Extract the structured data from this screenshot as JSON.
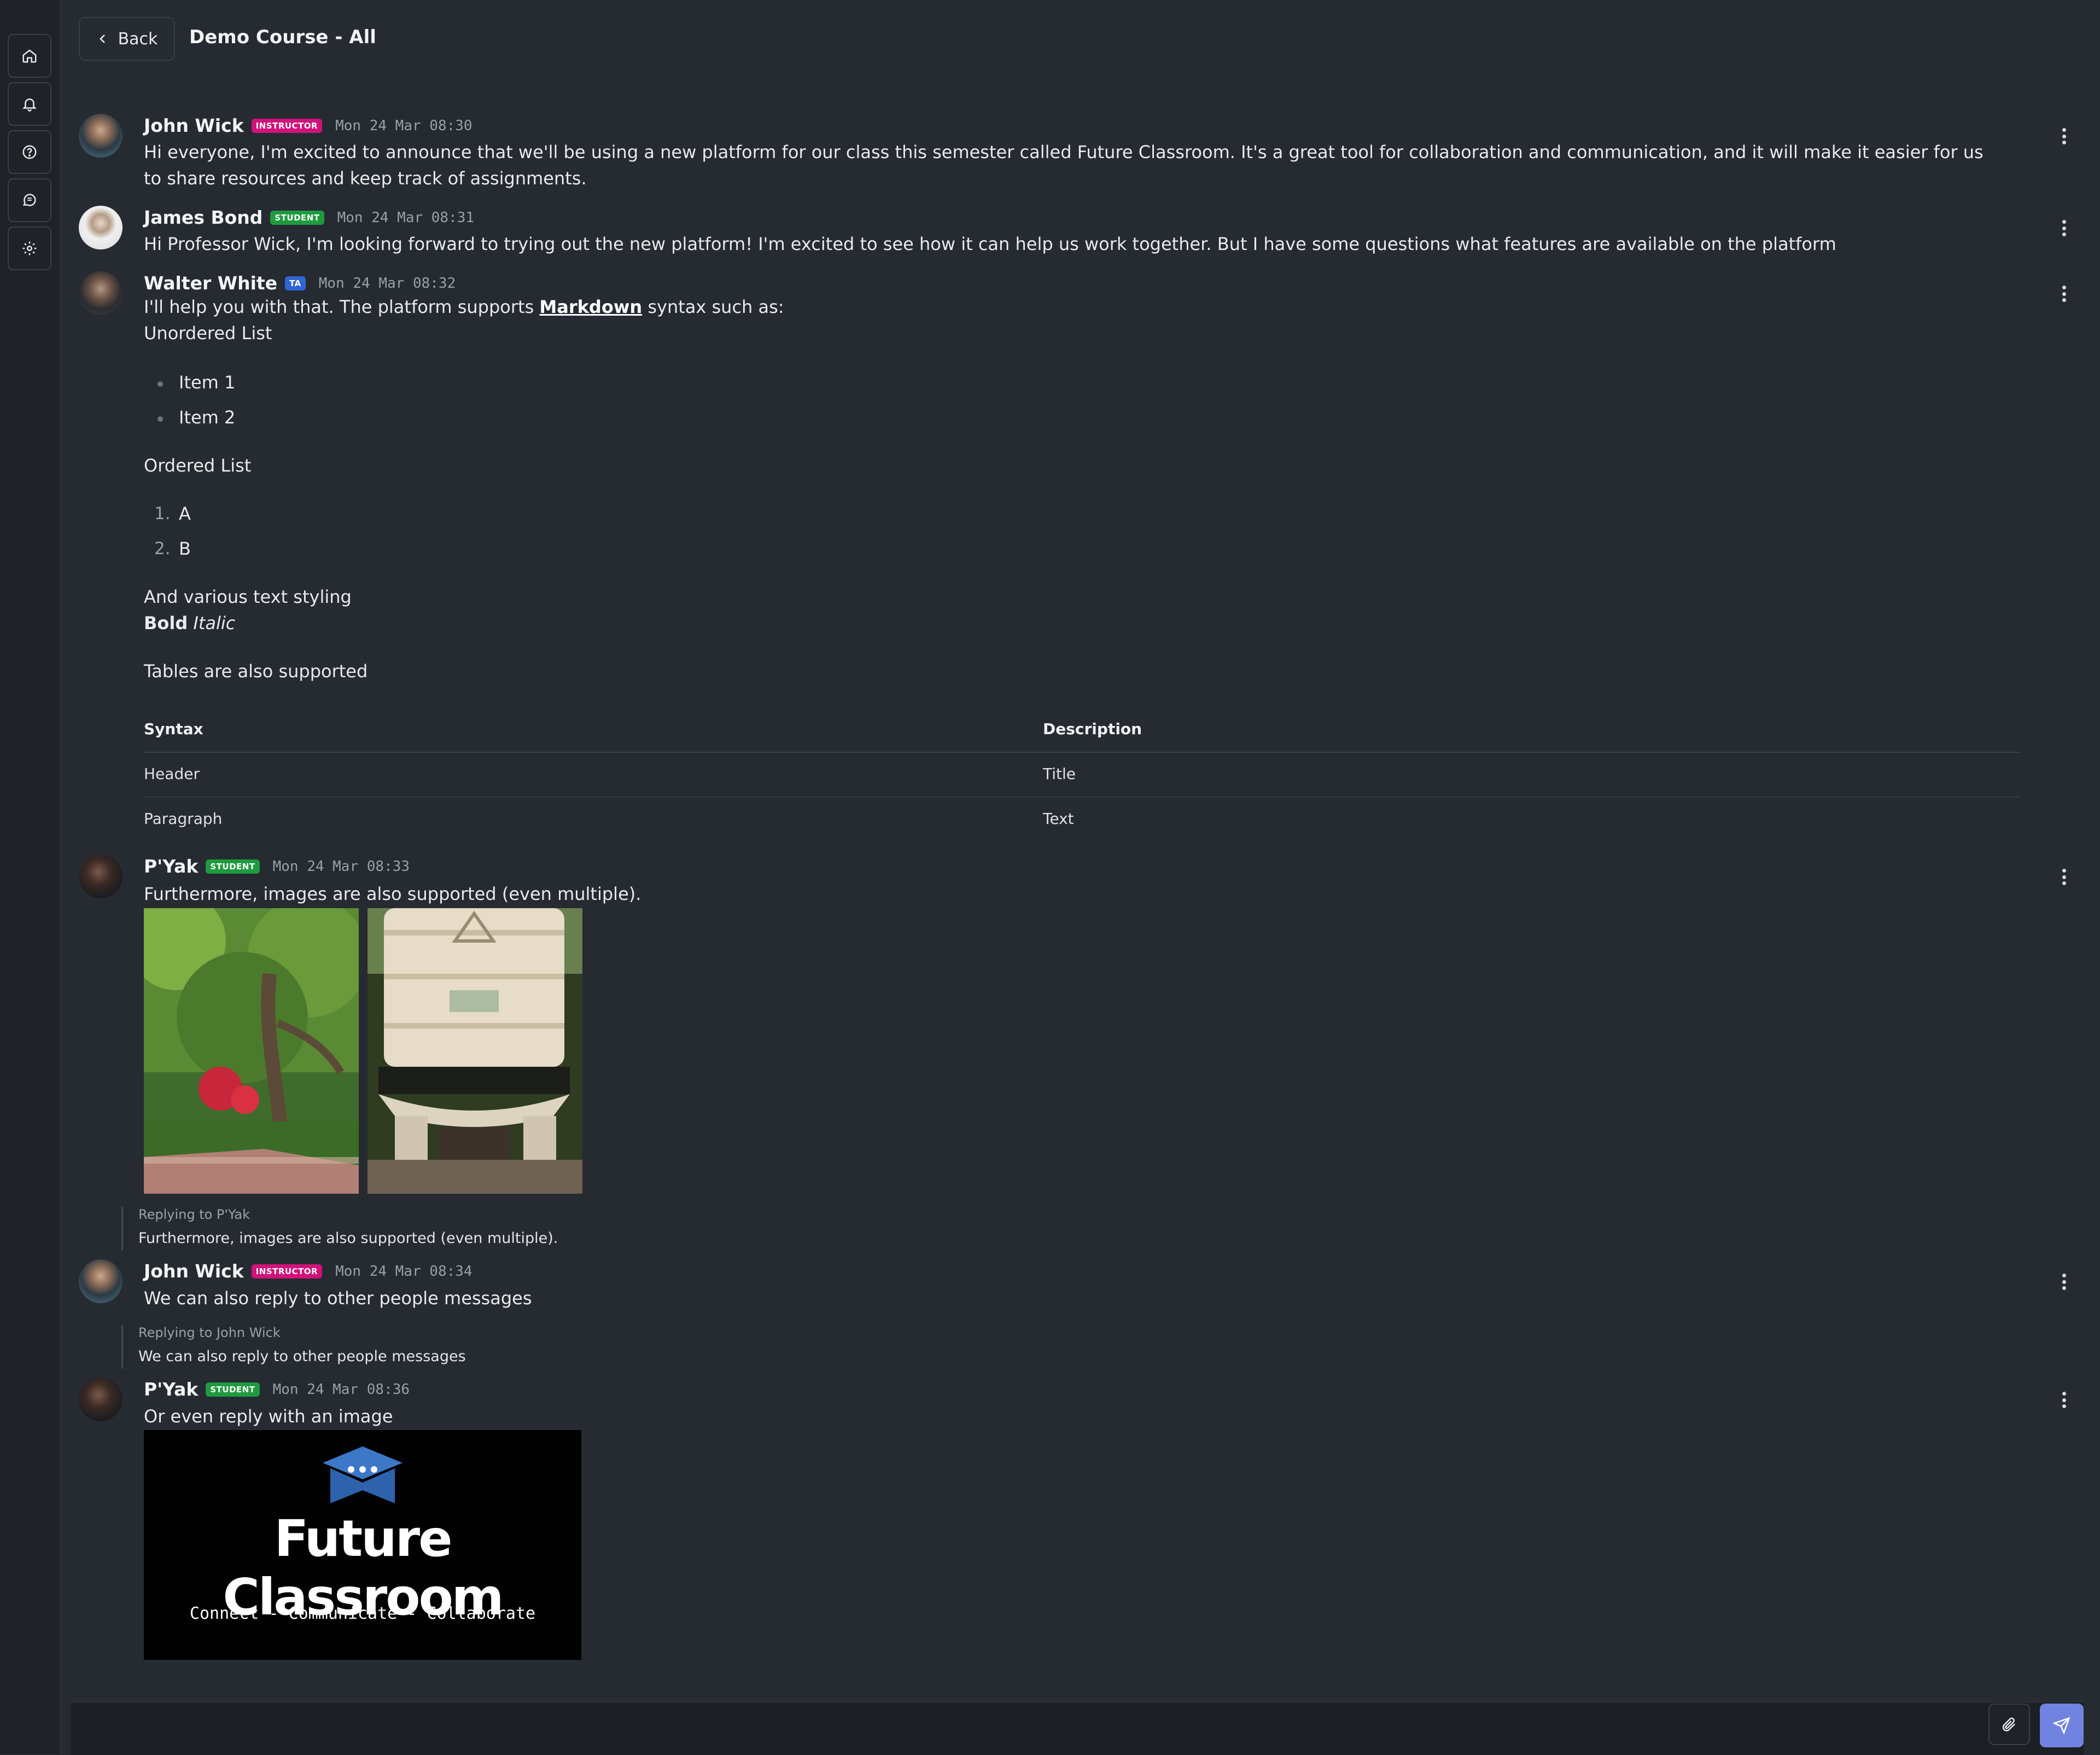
{
  "rail": {
    "items": [
      "home-icon",
      "bell-icon",
      "help-icon",
      "chat-icon",
      "gear-icon"
    ]
  },
  "header": {
    "back_label": "Back",
    "title": "Demo Course - All"
  },
  "messages": [
    {
      "author": "John Wick",
      "badge": "INSTRUCTOR",
      "time": "Mon 24 Mar 08:30",
      "text": "Hi everyone, I'm excited to announce that we'll be using a new platform for our class this semester called Future Classroom. It's a great tool for collaboration and communication, and it will make it easier for us to share resources and keep track of assignments."
    },
    {
      "author": "James Bond",
      "badge": "STUDENT",
      "time": "Mon 24 Mar 08:31",
      "text": "Hi Professor Wick, I'm looking forward to trying out the new platform! I'm excited to see how it can help us work together. But I have some questions what features are available on the platform"
    },
    {
      "author": "Walter White",
      "badge": "TA",
      "time": "Mon 24 Mar 08:32",
      "intro_before": "I'll help you with that. The platform supports ",
      "intro_link": "Markdown",
      "intro_after": " syntax such as:",
      "unordered_heading": "Unordered List",
      "unordered_items": [
        "Item 1",
        "Item 2"
      ],
      "ordered_heading": "Ordered List",
      "ordered_items": [
        "A",
        "B"
      ],
      "ordered_markers": [
        "1.",
        "2."
      ],
      "styling_heading": "And various text styling",
      "bold": "Bold",
      "italic": "Italic",
      "tables_heading": "Tables are also supported",
      "table": {
        "headers": [
          "Syntax",
          "Description"
        ],
        "rows": [
          [
            "Header",
            "Title"
          ],
          [
            "Paragraph",
            "Text"
          ]
        ]
      }
    },
    {
      "author": "P'Yak",
      "badge": "STUDENT",
      "time": "Mon 24 Mar 08:33",
      "text": "Furthermore, images are also supported (even multiple)."
    },
    {
      "author": "John Wick",
      "badge": "INSTRUCTOR",
      "time": "Mon 24 Mar 08:34",
      "reply_label": "Replying to P'Yak",
      "reply_text": "Furthermore, images are also supported (even multiple).",
      "text": "We can also reply to other people messages"
    },
    {
      "author": "P'Yak",
      "badge": "STUDENT",
      "time": "Mon 24 Mar 08:36",
      "reply_label": "Replying to John Wick",
      "reply_text": "We can also reply to other people messages",
      "text": "Or even reply with an image",
      "image_logo_title": "Future Classroom",
      "image_logo_tagline": "Connect - Communicate - Collaborate"
    }
  ],
  "composer": {
    "attach_icon": "paperclip-icon",
    "send_icon": "send-icon"
  },
  "colors": {
    "background": "#262a31",
    "instructor_badge": "#d1127a",
    "student_badge": "#1e9b3f",
    "ta_badge": "#2f66d6",
    "send_button": "#7183e0"
  }
}
